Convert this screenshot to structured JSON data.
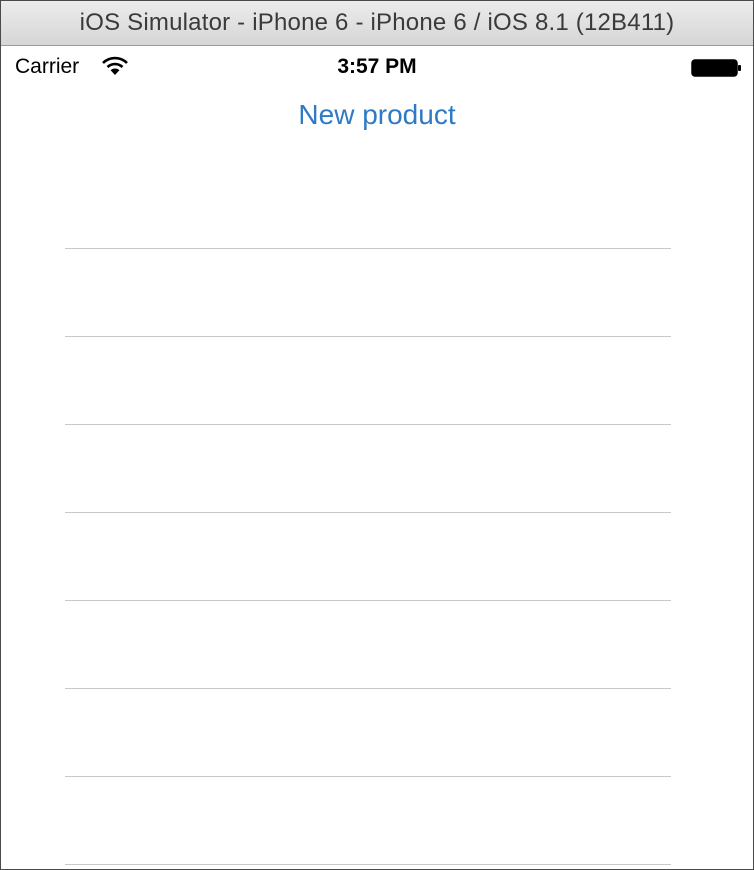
{
  "window": {
    "title": "iOS Simulator - iPhone 6 - iPhone 6 / iOS 8.1 (12B411)"
  },
  "status_bar": {
    "carrier": "Carrier",
    "time": "3:57 PM",
    "icons": [
      "wifi-icon",
      "battery-icon"
    ]
  },
  "screen": {
    "title": "New product",
    "title_color": "#2f7ac4"
  },
  "fields": [
    {
      "value": "",
      "placeholder": ""
    },
    {
      "value": "",
      "placeholder": ""
    },
    {
      "value": "",
      "placeholder": ""
    },
    {
      "value": "",
      "placeholder": ""
    },
    {
      "value": "",
      "placeholder": ""
    },
    {
      "value": "",
      "placeholder": ""
    },
    {
      "value": "",
      "placeholder": ""
    }
  ]
}
